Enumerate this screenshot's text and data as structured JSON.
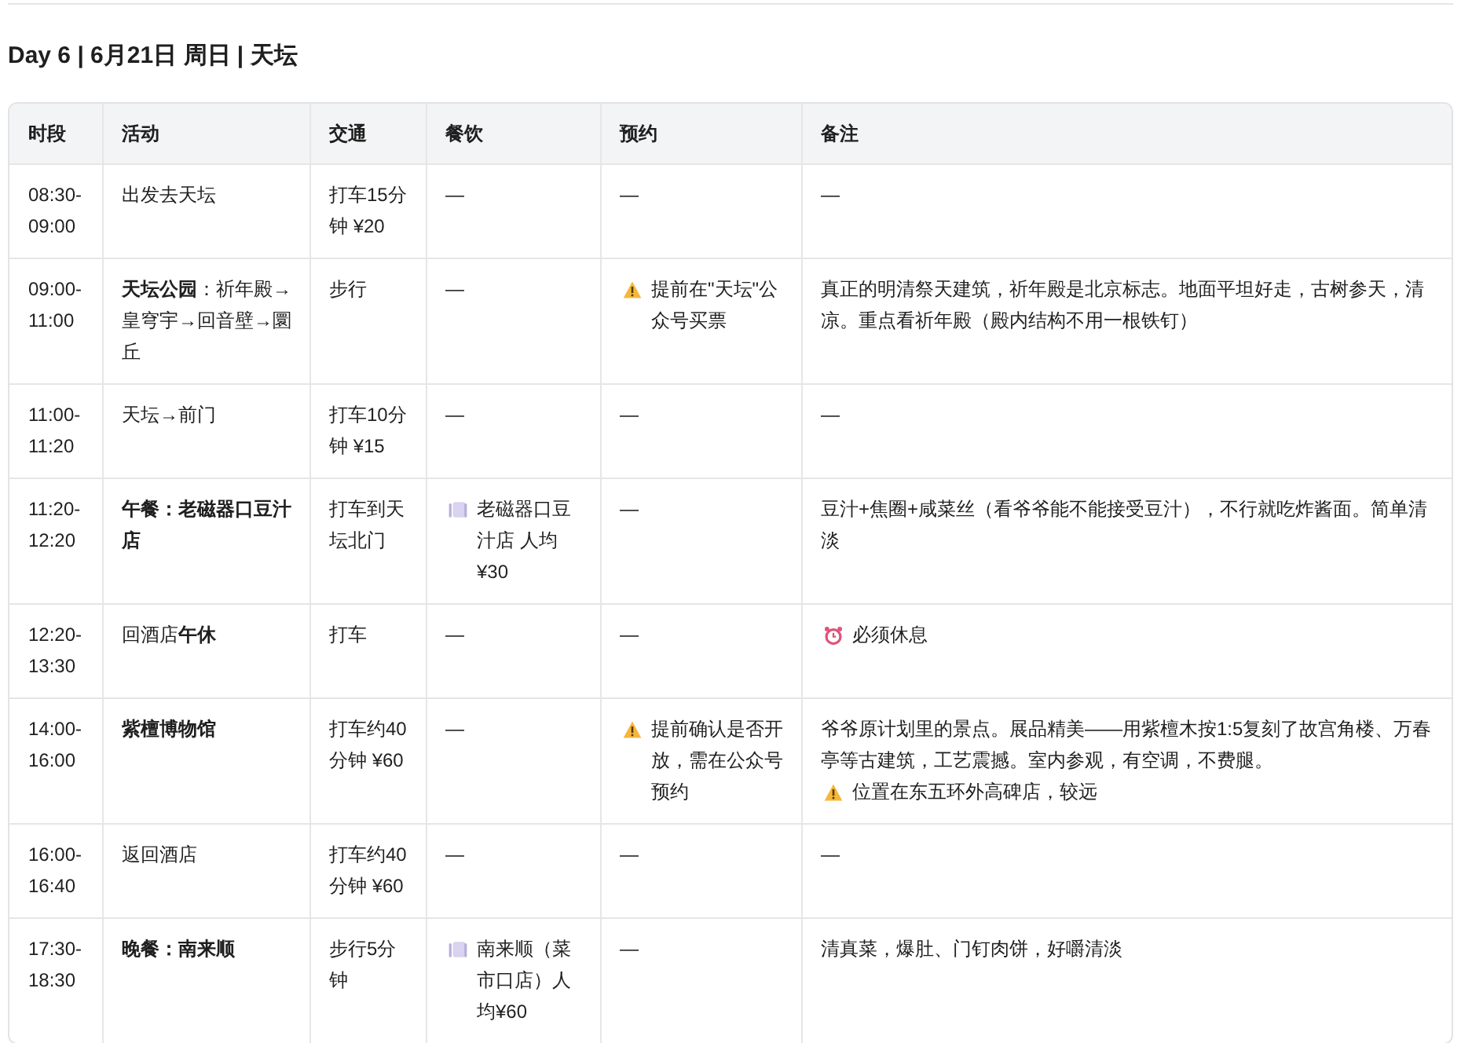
{
  "title": "Day 6 | 6月21日 周日 | 天坛",
  "table": {
    "columns": [
      "时段",
      "活动",
      "交通",
      "餐饮",
      "预约",
      "备注"
    ],
    "rows": [
      {
        "time": "08:30-09:00",
        "activity": {
          "text": "出发去天坛",
          "bold": false
        },
        "transport": "打车15分钟 ¥20",
        "dining": [
          {
            "kind": "text",
            "text": "—"
          }
        ],
        "booking": [
          {
            "kind": "text",
            "text": "—"
          }
        ],
        "notes": [
          {
            "kind": "text",
            "text": "—"
          }
        ]
      },
      {
        "time": "09:00-11:00",
        "activity": {
          "text": "**天坛公园**：祈年殿→皇穹宇→回音壁→圜丘",
          "bold": false
        },
        "transport": "步行",
        "dining": [
          {
            "kind": "text",
            "text": "—"
          }
        ],
        "booking": [
          {
            "kind": "warning"
          },
          {
            "kind": "text",
            "text": "提前在\"天坛\"公众号买票"
          }
        ],
        "notes": [
          {
            "kind": "text",
            "text": "真正的明清祭天建筑，祈年殿是北京标志。地面平坦好走，古树参天，清凉。重点看祈年殿（殿内结构不用一根铁钉）"
          }
        ]
      },
      {
        "time": "11:00-11:20",
        "activity": {
          "text": "天坛→前门",
          "bold": false
        },
        "transport": "打车10分钟 ¥15",
        "dining": [
          {
            "kind": "text",
            "text": "—"
          }
        ],
        "booking": [
          {
            "kind": "text",
            "text": "—"
          }
        ],
        "notes": [
          {
            "kind": "text",
            "text": "—"
          }
        ]
      },
      {
        "time": "11:20-12:20",
        "activity": {
          "text": "午餐：老磁器口豆汁店",
          "bold": true
        },
        "transport": "打车到天坛北门",
        "dining": [
          {
            "kind": "meal"
          },
          {
            "kind": "text",
            "text": "老磁器口豆汁店 人均¥30"
          }
        ],
        "booking": [
          {
            "kind": "text",
            "text": "—"
          }
        ],
        "notes": [
          {
            "kind": "text",
            "text": "豆汁+焦圈+咸菜丝（看爷爷能不能接受豆汁），不行就吃炸酱面。简单清淡"
          }
        ]
      },
      {
        "time": "12:20-13:30",
        "activity": {
          "text": "回酒店**午休**",
          "bold": false
        },
        "transport": "打车",
        "dining": [
          {
            "kind": "text",
            "text": "—"
          }
        ],
        "booking": [
          {
            "kind": "text",
            "text": "—"
          }
        ],
        "notes": [
          {
            "kind": "alarm"
          },
          {
            "kind": "text",
            "text": "必须休息"
          }
        ]
      },
      {
        "time": "14:00-16:00",
        "activity": {
          "text": "紫檀博物馆",
          "bold": true
        },
        "transport": "打车约40分钟 ¥60",
        "dining": [
          {
            "kind": "text",
            "text": "—"
          }
        ],
        "booking": [
          {
            "kind": "warning"
          },
          {
            "kind": "text",
            "text": "提前确认是否开放，需在公众号预约"
          }
        ],
        "notes": [
          {
            "kind": "text",
            "text": "爷爷原计划里的景点。展品精美——用紫檀木按1:5复刻了故宫角楼、万春亭等古建筑，工艺震撼。室内参观，有空调，不费腿。"
          },
          {
            "kind": "warning"
          },
          {
            "kind": "text",
            "text": "位置在东五环外高碑店，较远"
          }
        ]
      },
      {
        "time": "16:00-16:40",
        "activity": {
          "text": "返回酒店",
          "bold": false
        },
        "transport": "打车约40分钟 ¥60",
        "dining": [
          {
            "kind": "text",
            "text": "—"
          }
        ],
        "booking": [
          {
            "kind": "text",
            "text": "—"
          }
        ],
        "notes": [
          {
            "kind": "text",
            "text": "—"
          }
        ]
      },
      {
        "time": "17:30-18:30",
        "activity": {
          "text": "晚餐：南来顺",
          "bold": true
        },
        "transport": "步行5分钟",
        "dining": [
          {
            "kind": "meal"
          },
          {
            "kind": "text",
            "text": "南来顺（菜市口店）人均¥60"
          }
        ],
        "booking": [
          {
            "kind": "text",
            "text": "—"
          }
        ],
        "notes": [
          {
            "kind": "text",
            "text": "清真菜，爆肚、门钉肉饼，好嚼清淡"
          }
        ]
      }
    ]
  }
}
